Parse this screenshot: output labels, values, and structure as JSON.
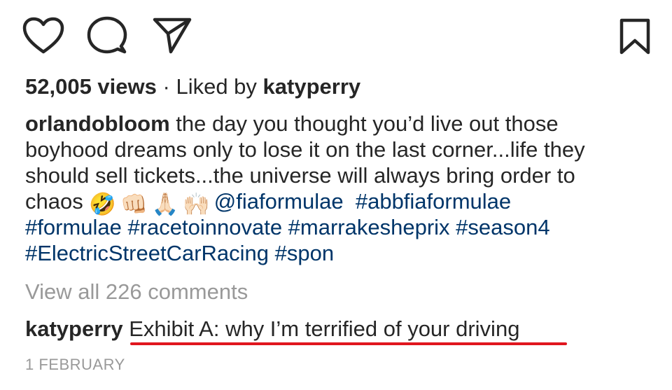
{
  "actions": {
    "like_icon": "heart-icon",
    "comment_icon": "speech-bubble-icon",
    "share_icon": "paper-plane-icon",
    "save_icon": "bookmark-icon"
  },
  "stats": {
    "views": "52,005 views",
    "separator": " · ",
    "liked_by_prefix": "Liked by ",
    "liked_by_user": "katyperry"
  },
  "caption": {
    "username": "orlandobloom",
    "line1_text": " the day you thought you’d live out those",
    "line2_text": "boyhood dreams only to lose it on the last corner...life they",
    "line3_text": "should sell tickets...the universe will always bring order to",
    "line4_text": "chaos ",
    "emojis": [
      "🤣",
      "👊🏻",
      "🙏🏻",
      "🙌🏻"
    ],
    "mention": "@fiaformulae",
    "hashtags_line4": "#abbfiaformulae",
    "hashtags_line5": "#formulae #racetoinnovate #marrakesheprix #season4",
    "hashtags_line6": "#ElectricStreetCarRacing #spon"
  },
  "view_comments": "View all 226 comments",
  "top_comment": {
    "username": "katyperry",
    "text": "Exhibit A: why I’m terrified of your driving"
  },
  "date": "1 FEBRUARY",
  "colors": {
    "text": "#262626",
    "link": "#003569",
    "muted": "#999999",
    "highlight_underline": "#e0161e"
  }
}
